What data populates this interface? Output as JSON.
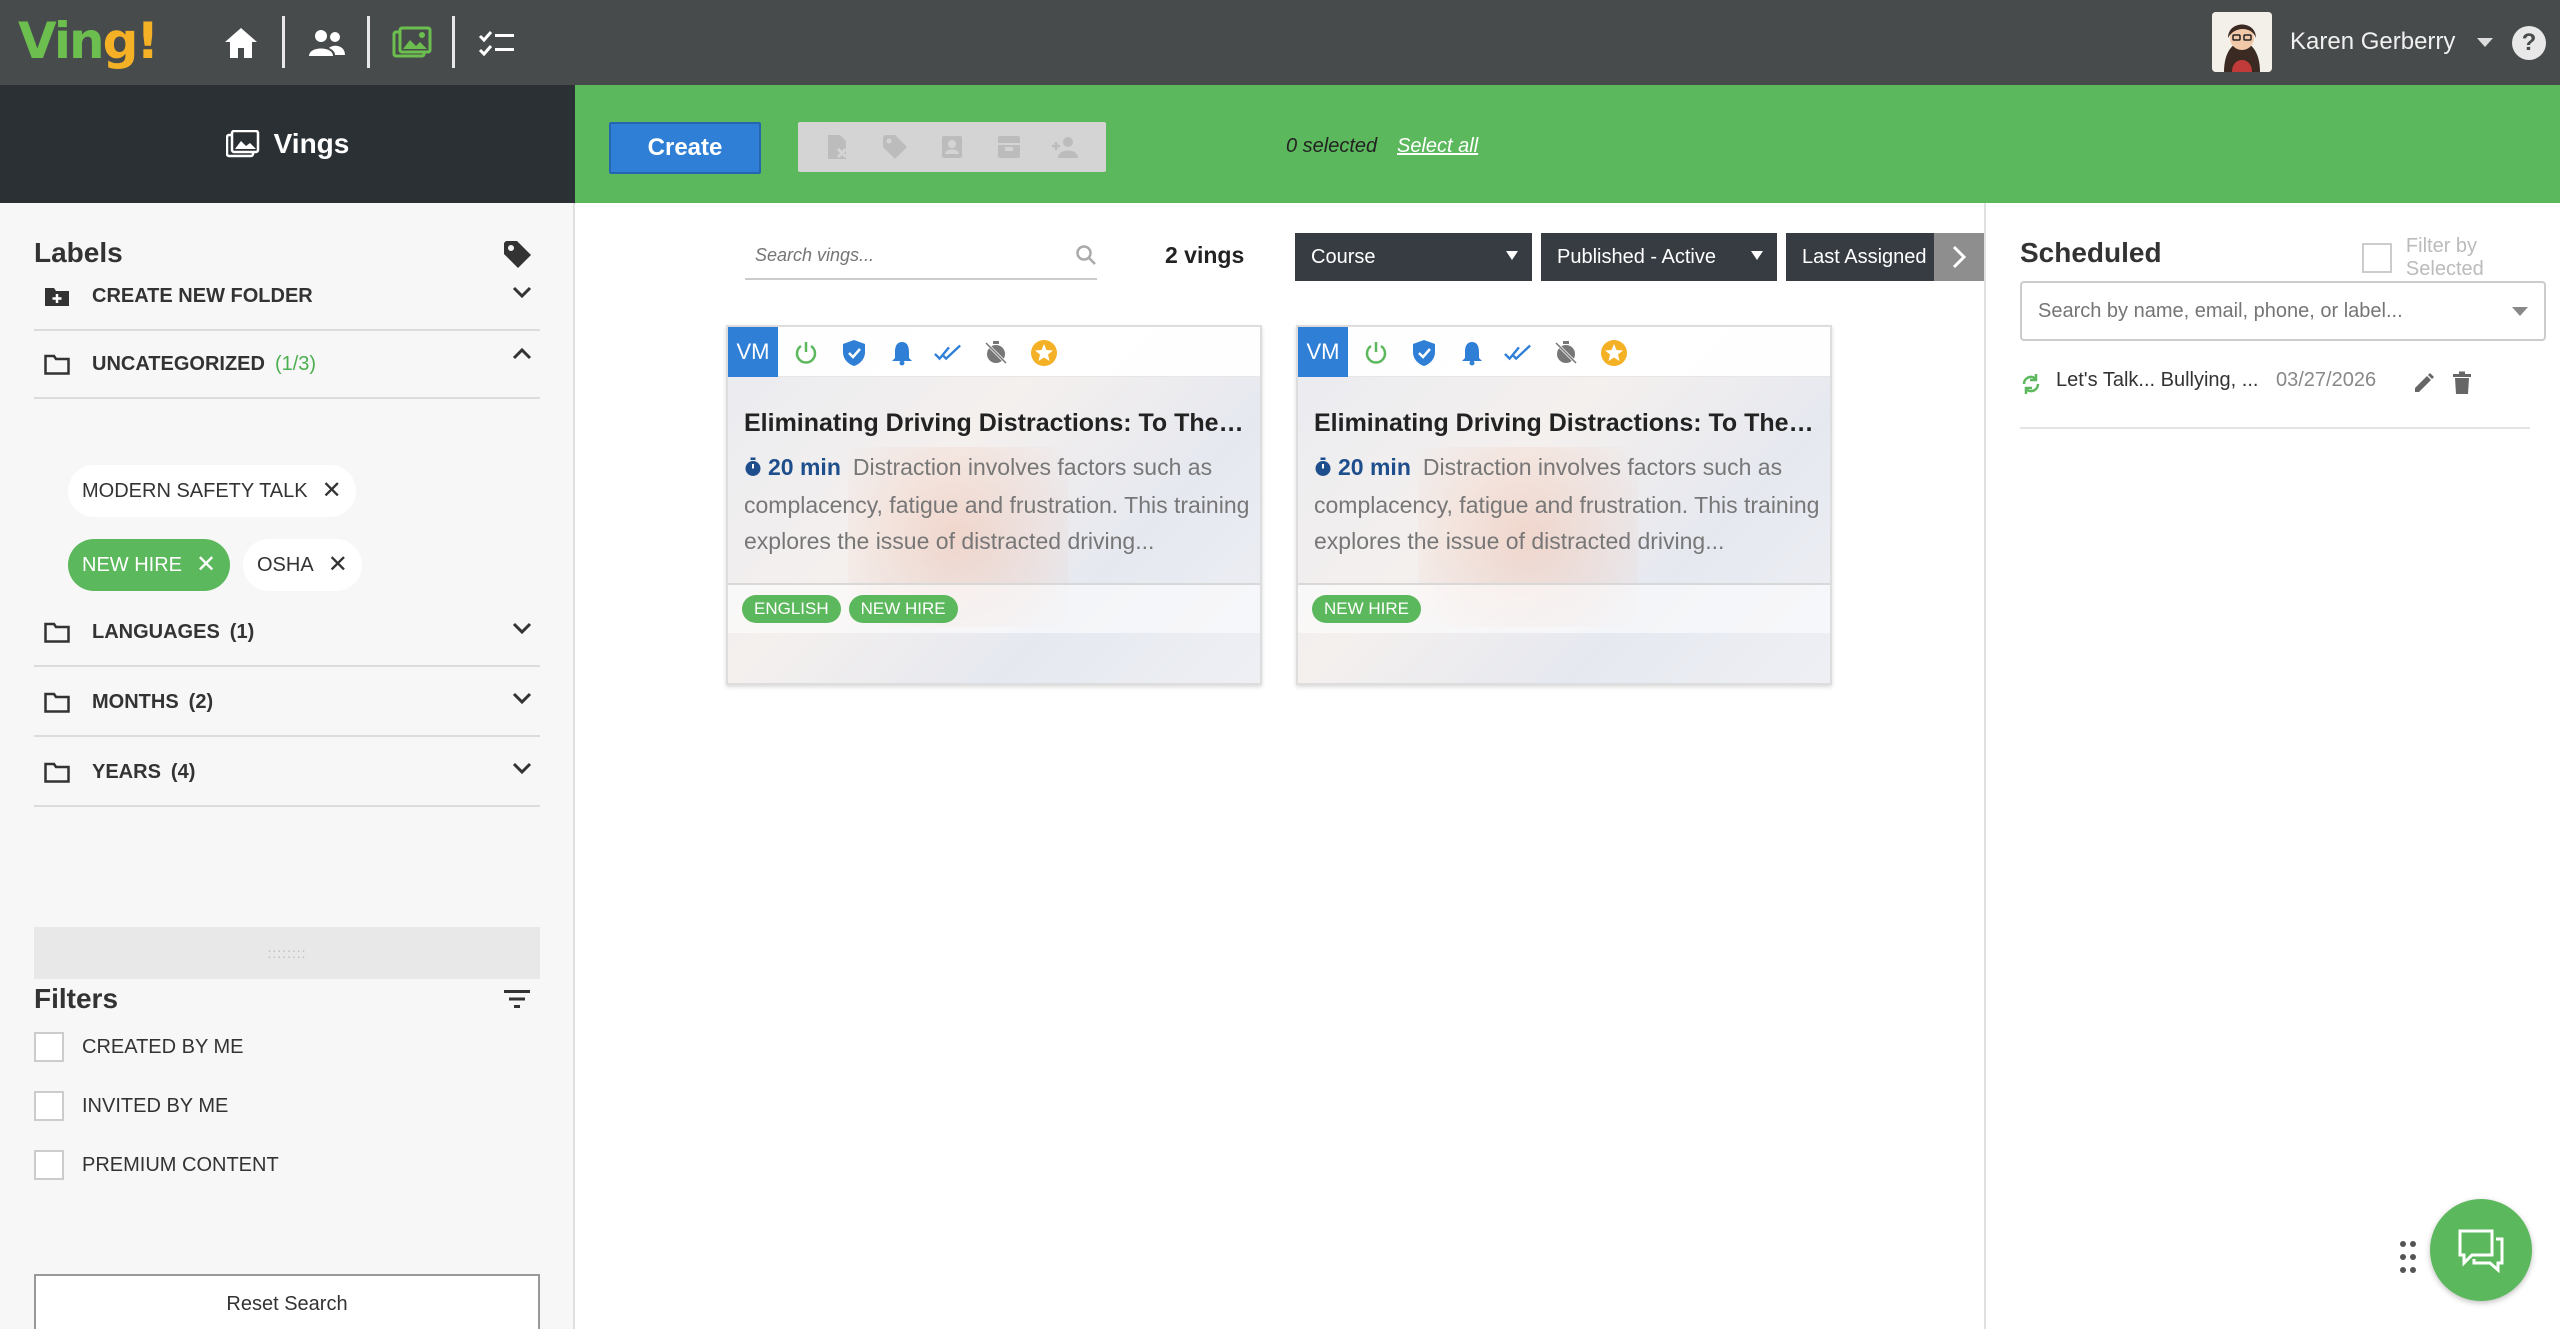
{
  "app": {
    "logo_text": "Ving!",
    "logo_main": "Vin",
    "logo_accent": "g!",
    "brand_green": "#5cb85c",
    "brand_blue": "#2f7fd6"
  },
  "nav": {
    "items": [
      "home-icon",
      "people-icon",
      "images-icon",
      "checklist-icon"
    ]
  },
  "user": {
    "name": "Karen Gerberry",
    "help_label": "?"
  },
  "header": {
    "section_title": "Vings",
    "create_label": "Create",
    "selected_text": "0 selected",
    "select_all_label": "Select all",
    "action_icons": [
      "remove-file-icon",
      "tag-icon",
      "contact-card-icon",
      "archive-icon",
      "assign-user-icon"
    ]
  },
  "sidebar": {
    "labels_title": "Labels",
    "folders": [
      {
        "label": "CREATE NEW FOLDER",
        "count": ""
      },
      {
        "label": "UNCATEGORIZED",
        "count": "(1/3)"
      },
      {
        "label": "LANGUAGES",
        "count": "(1)"
      },
      {
        "label": "MONTHS",
        "count": "(2)"
      },
      {
        "label": "YEARS",
        "count": "(4)"
      }
    ],
    "chips": [
      {
        "label": "MODERN SAFETY TALK",
        "selected": false
      },
      {
        "label": "NEW HIRE",
        "selected": true
      },
      {
        "label": "OSHA",
        "selected": false
      }
    ],
    "grip": "::::::::",
    "filters_title": "Filters",
    "filters": [
      {
        "label": "CREATED BY ME",
        "checked": false
      },
      {
        "label": "INVITED BY ME",
        "checked": false
      },
      {
        "label": "PREMIUM CONTENT",
        "checked": false
      }
    ],
    "reset_label": "Reset Search"
  },
  "main": {
    "search_placeholder": "Search vings...",
    "ving_count": "2 vings",
    "type_filter": "Course",
    "status_filter": "Published - Active",
    "sort_label": "Last Assigned",
    "cards": [
      {
        "badge": "VM",
        "title": "Eliminating Driving Distractions: To The P...",
        "duration": "20 min",
        "description": "Distraction involves factors such as complacency, fatigue and frustration. This training explores the issue of distracted driving...",
        "tags": [
          "ENGLISH",
          "NEW HIRE"
        ]
      },
      {
        "badge": "VM",
        "title": "Eliminating Driving Distractions: To The P...",
        "duration": "20 min",
        "description": "Distraction involves factors such as complacency, fatigue and frustration. This training explores the issue of distracted driving...",
        "tags": [
          "NEW HIRE"
        ]
      }
    ]
  },
  "scheduled": {
    "title": "Scheduled",
    "filter_by_selected": "Filter by Selected",
    "search_placeholder": "Search by name, email, phone, or label...",
    "items": [
      {
        "name": "Let's Talk... Bullying, ...",
        "date": "03/27/2026"
      }
    ]
  }
}
